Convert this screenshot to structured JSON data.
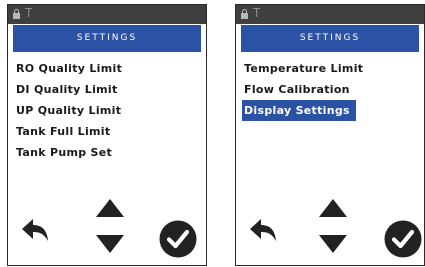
{
  "screens": [
    {
      "status": {
        "icon": "lock-icon",
        "label": "T"
      },
      "title": "SETTINGS",
      "items": [
        {
          "label": "RO Quality Limit",
          "selected": false
        },
        {
          "label": "DI Quality Limit",
          "selected": false
        },
        {
          "label": "UP Quality Limit",
          "selected": false
        },
        {
          "label": "Tank Full Limit",
          "selected": false
        },
        {
          "label": "Tank Pump Set",
          "selected": false
        }
      ],
      "controls": {
        "back": "back-arrow-icon",
        "up": "up-arrow-icon",
        "down": "down-arrow-icon",
        "ok": "checkmark-icon"
      }
    },
    {
      "status": {
        "icon": "lock-icon",
        "label": "T"
      },
      "title": "SETTINGS",
      "items": [
        {
          "label": "Temperature Limit",
          "selected": false
        },
        {
          "label": "Flow Calibration",
          "selected": false
        },
        {
          "label": "Display Settings",
          "selected": true
        }
      ],
      "controls": {
        "back": "back-arrow-icon",
        "up": "up-arrow-icon",
        "down": "down-arrow-icon",
        "ok": "checkmark-icon"
      }
    }
  ],
  "colors": {
    "header": "#2c52a5",
    "status_bar": "#3f3f3f",
    "text": "#1a1a1a",
    "button": "#222222"
  }
}
